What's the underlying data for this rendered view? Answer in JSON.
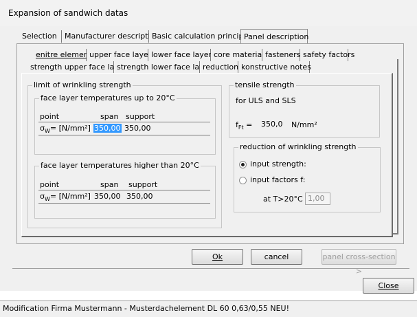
{
  "window": {
    "title": "Expansion of sandwich datas"
  },
  "main_tabs": [
    {
      "label": "Selection"
    },
    {
      "label": "Manufacturer description"
    },
    {
      "label": "Basic calculation principle"
    },
    {
      "label": "Panel description"
    }
  ],
  "sub_tabs_row1": [
    {
      "label": "enitre element"
    },
    {
      "label": "upper face layer"
    },
    {
      "label": "lower face layer"
    },
    {
      "label": "core material"
    },
    {
      "label": "fasteners"
    },
    {
      "label": "safety factors"
    }
  ],
  "sub_tabs_row2": [
    {
      "label": "strength upper face layer"
    },
    {
      "label": "strength lower face layer"
    },
    {
      "label": "reduction"
    },
    {
      "label": "konstructive notes"
    }
  ],
  "wrinkling": {
    "caption": "limit of wrinkling strength",
    "up_to_20": {
      "caption": "face layer temperatures up to 20°C",
      "col_point": "point",
      "col_span": "span",
      "col_support": "support",
      "row_label": "σ",
      "row_sub": "W",
      "row_unit": "= [N/mm²]",
      "span_value": "350,00",
      "support_value": "350,00"
    },
    "higher_20": {
      "caption": "face layer temperatures higher than 20°C",
      "col_point": "point",
      "col_span": "span",
      "col_support": "support",
      "row_label": "σ",
      "row_sub": "W",
      "row_unit": "= [N/mm²]",
      "span_value": "350,00",
      "support_value": "350,00"
    }
  },
  "tensile": {
    "caption": "tensile strength",
    "note": "for ULS and SLS",
    "label": "f",
    "label_sub": "Ft",
    "eq": "=",
    "value": "350,0",
    "unit": "N/mm²"
  },
  "reduction": {
    "caption": "reduction of wrinkling strength",
    "option_strength": "input strength:",
    "option_factors": "input factors f:",
    "temp_label": "at T>20°C",
    "factor_value": "1,00",
    "selected": "input strength:"
  },
  "buttons": {
    "ok": "Ok",
    "cancel": "cancel",
    "panel_cross_section": "panel cross-section >",
    "close": "Close"
  },
  "status": {
    "text": "Modification Firma Mustermann - Musterdachelement DL 60 0,63/0,55 NEU!"
  }
}
